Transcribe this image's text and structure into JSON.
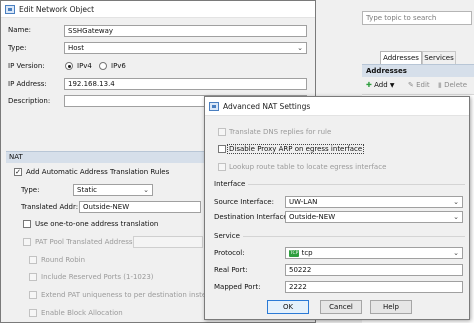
{
  "edit_network_object": {
    "title": "Edit Network Object",
    "name_label": "Name:",
    "name_value": "SSHGateway",
    "type_label": "Type:",
    "type_value": "Host",
    "ip_version_label": "IP Version:",
    "ipv4_label": "IPv4",
    "ipv6_label": "IPv6",
    "ip_address_label": "IP Address:",
    "ip_address_value": "192.168.13.4",
    "description_label": "Description:",
    "description_value": "",
    "nat_section": "NAT",
    "add_auto_nat_label": "Add Automatic Address Translation Rules",
    "nat_type_label": "Type:",
    "nat_type_value": "Static",
    "translated_addr_label": "Translated Addr:",
    "translated_addr_value": "Outside-NEW",
    "one_to_one_label": "Use one-to-one address translation",
    "pat_pool_label": "PAT Pool Translated Address:",
    "round_robin_label": "Round Robin",
    "include_reserved_label": "Include Reserved Ports (1-1023)",
    "extend_pat_label": "Extend PAT uniqueness to per destination instead o",
    "block_alloc_label": "Enable Block Allocation"
  },
  "right_panel": {
    "search_placeholder": "Type topic to search",
    "tab_addresses": "Addresses",
    "tab_services": "Services",
    "addresses_header": "Addresses",
    "add_label": "Add",
    "edit_label": "Edit",
    "delete_label": "Delete"
  },
  "advanced_nat": {
    "title": "Advanced NAT Settings",
    "translate_dns_label": "Translate DNS replies for rule",
    "disable_proxy_arp_label": "Disable Proxy ARP on egress interface",
    "lookup_route_label": "Lookup route table to locate egress interface",
    "interface_group": "Interface",
    "source_interface_label": "Source Interface:",
    "source_interface_value": "UW-LAN",
    "dest_interface_label": "Destination Interface:",
    "dest_interface_value": "Outside-NEW",
    "service_group": "Service",
    "protocol_label": "Protocol:",
    "protocol_badge": "TCP",
    "protocol_value": "tcp",
    "real_port_label": "Real Port:",
    "real_port_value": "50222",
    "mapped_port_label": "Mapped Port:",
    "mapped_port_value": "2222",
    "ok_label": "OK",
    "cancel_label": "Cancel",
    "help_label": "Help"
  },
  "colors": {
    "accent": "#2b7ad6",
    "section_header": "#d6dfea",
    "protocol_badge": "#2e9e3e"
  }
}
